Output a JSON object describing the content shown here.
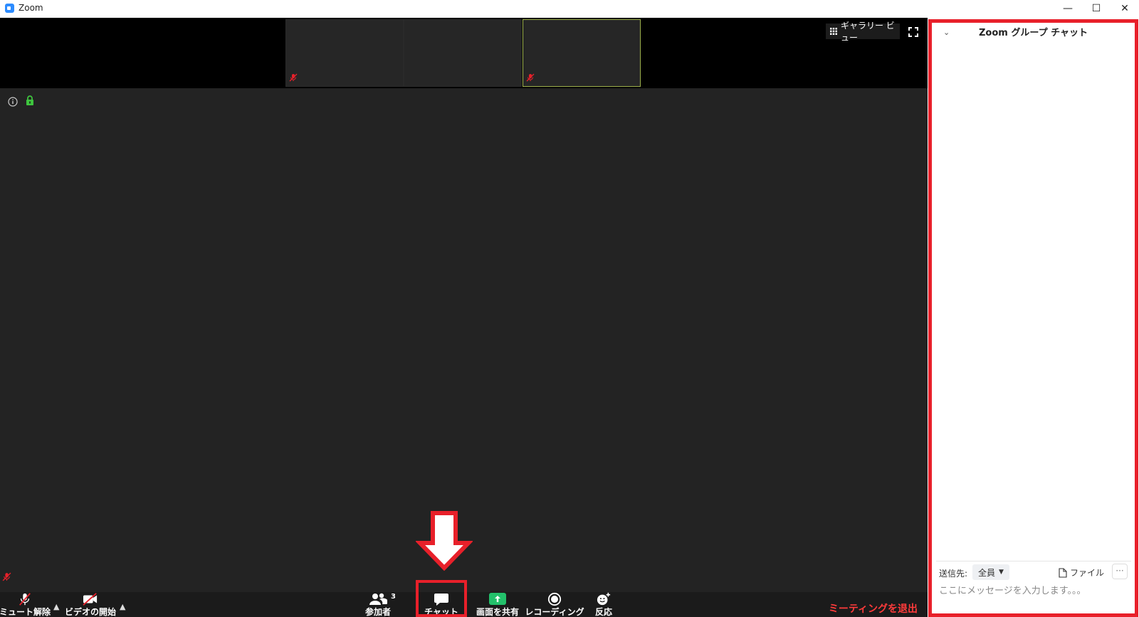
{
  "window": {
    "title": "Zoom",
    "minimize": "—",
    "maximize": "☐",
    "close": "✕"
  },
  "video": {
    "gallery_view_label": "ギャラリー ビュー"
  },
  "toolbar": {
    "unmute": "ミュート解除",
    "start_video": "ビデオの開始",
    "participants": "参加者",
    "participants_count": "3",
    "chat": "チャット",
    "share_screen": "画面を共有",
    "recording": "レコーディング",
    "reactions": "反応",
    "leave": "ミーティングを退出"
  },
  "chat": {
    "header": "Zoom グループ チャット",
    "to_label": "送信先:",
    "to_value": "全員",
    "file_label": "ファイル",
    "more_label": "···",
    "input_placeholder": "ここにメッセージを入力します。。。"
  },
  "colors": {
    "highlight": "#e8202a",
    "meeting_bg": "#232323",
    "share_green": "#23c16b",
    "leave_red": "#ff3b3b"
  }
}
